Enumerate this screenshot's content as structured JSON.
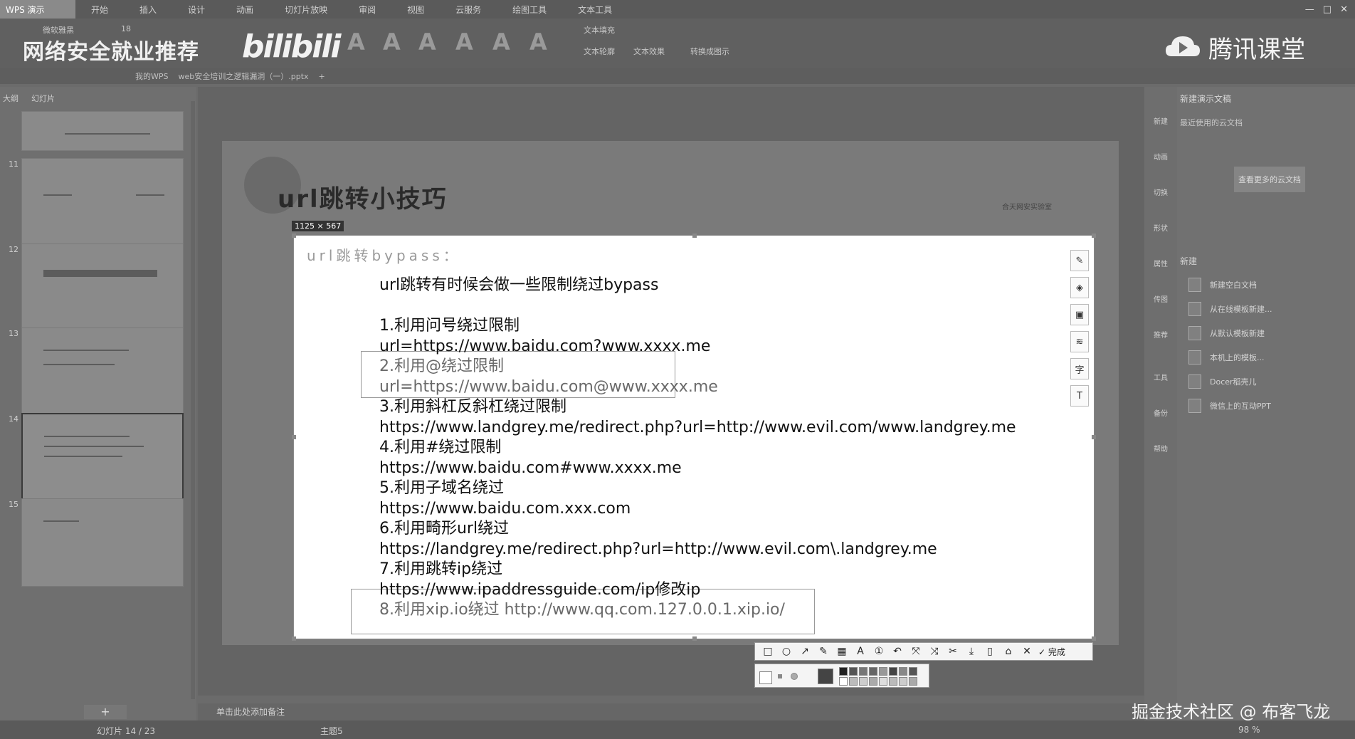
{
  "app": {
    "logo": "WPS 演示",
    "tabs": [
      "开始",
      "插入",
      "设计",
      "动画",
      "切灯片放映",
      "审阅",
      "视图",
      "云服务",
      "绘图工具",
      "文本工具"
    ],
    "doc_tabs": [
      "我的WPS",
      "web安全培训之逻辑漏洞（一）.pptx"
    ],
    "ribbon": {
      "text_fill": "文本填充",
      "text_outline": "文本轮廓",
      "text_effect": "文本效果",
      "convert_graphic": "转换成图示",
      "font_size": "18",
      "font_name": "微软雅黑"
    }
  },
  "watermarks": {
    "left_text": "网络安全就业推荐",
    "bili": "bilibili",
    "right_text": "腾讯课堂",
    "bottom_text": "掘金技术社区 @ 布客飞龙"
  },
  "left_panel": {
    "tabs": [
      "大纲",
      "幻灯片"
    ],
    "slide_numbers": [
      "11",
      "12",
      "13",
      "14",
      "15"
    ]
  },
  "slide": {
    "title": "url跳转小技巧",
    "logo_text": "合天网安实验室"
  },
  "selection": {
    "size_label": "1125 × 567",
    "heading": "url跳转bypass：",
    "lines": [
      "url跳转有时候会做一些限制绕过bypass",
      "",
      "1.利用问号绕过限制",
      "url=https://www.baidu.com?www.xxxx.me",
      "2.利用@绕过限制",
      "url=https://www.baidu.com@www.xxxx.me",
      "3.利用斜杠反斜杠绕过限制",
      "https://www.landgrey.me/redirect.php?url=http://www.evil.com/www.landgrey.me",
      "4.利用#绕过限制",
      "https://www.baidu.com#www.xxxx.me",
      "5.利用子域名绕过",
      "https://www.baidu.com.xxx.com",
      "6.利用畸形url绕过",
      "https://landgrey.me/redirect.php?url=http://www.evil.com\\.landgrey.me",
      "7.利用跳转ip绕过",
      "https://www.ipaddressguide.com/ip修改ip",
      "8.利用xip.io绕过 http://www.qq.com.127.0.0.1.xip.io/"
    ],
    "side_tools": [
      "✎",
      "◈",
      "▣",
      "≋",
      "字",
      "T"
    ]
  },
  "snip_toolbar": {
    "tools": [
      "□",
      "○",
      "↗",
      "✎",
      "▦",
      "A",
      "①",
      "↶",
      "⤧",
      "⤨",
      "✂",
      "⤓",
      "▯",
      "⌂",
      "✕"
    ],
    "done": "✓ 完成"
  },
  "right_strip": [
    "新建",
    "动画",
    "切换",
    "形状",
    "属性",
    "传图",
    "推荐",
    "工具",
    "备份",
    "帮助"
  ],
  "right_pane": {
    "title": "新建演示文稿",
    "recent": "最近使用的云文档",
    "open_button": "查看更多的云文档",
    "new_heading": "新建",
    "items": [
      "新建空白文档",
      "从在线模板新建...",
      "从默认模板新建",
      "本机上的模板...",
      "Docer稻壳儿",
      "微信上的互动PPT"
    ]
  },
  "notes": "单击此处添加备注",
  "status": {
    "slide": "幻灯片 14 / 23",
    "theme": "主题5",
    "zoom": "98 %"
  }
}
